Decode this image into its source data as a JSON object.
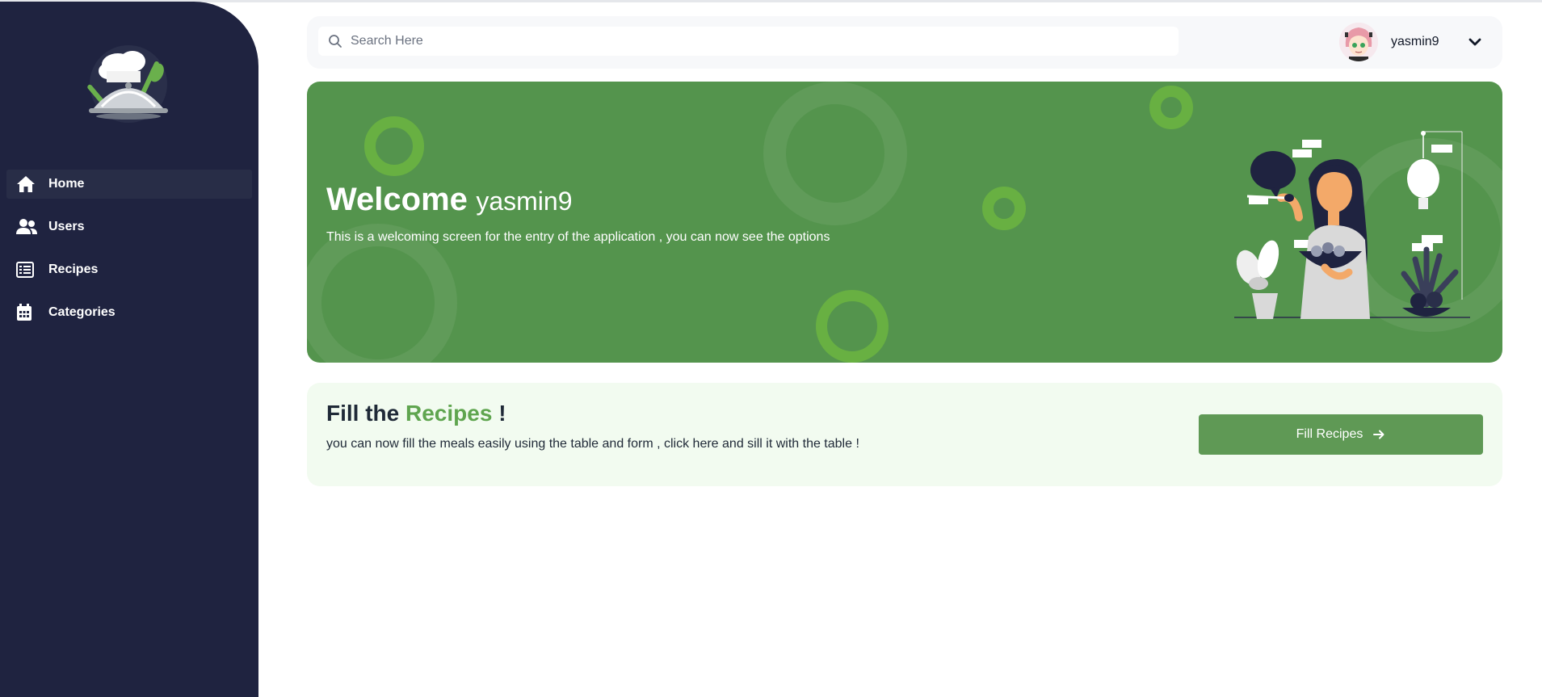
{
  "sidebar": {
    "items": [
      {
        "label": "Home",
        "icon": "home-icon",
        "active": true
      },
      {
        "label": "Users",
        "icon": "users-icon",
        "active": false
      },
      {
        "label": "Recipes",
        "icon": "table-list-icon",
        "active": false
      },
      {
        "label": "Categories",
        "icon": "calendar-icon",
        "active": false
      }
    ]
  },
  "header": {
    "search_placeholder": "Search Here",
    "user_name": "yasmin9"
  },
  "banner": {
    "welcome": "Welcome",
    "user_name": "yasmin9",
    "subtitle": "This is a welcoming screen for the entry of the application , you can now see the options"
  },
  "fill_card": {
    "title_prefix": "Fill the",
    "title_accent": "Recipes",
    "title_suffix": "!",
    "subtitle": "you can now fill the meals easily using the table and form , click here and sill it with the table !",
    "button_label": "Fill Recipes"
  },
  "colors": {
    "sidebar_bg": "#1f2340",
    "banner_bg": "#54944d",
    "accent_green": "#5fa54f",
    "button_green": "#5f9955",
    "card_bg": "#f2fbf0"
  }
}
